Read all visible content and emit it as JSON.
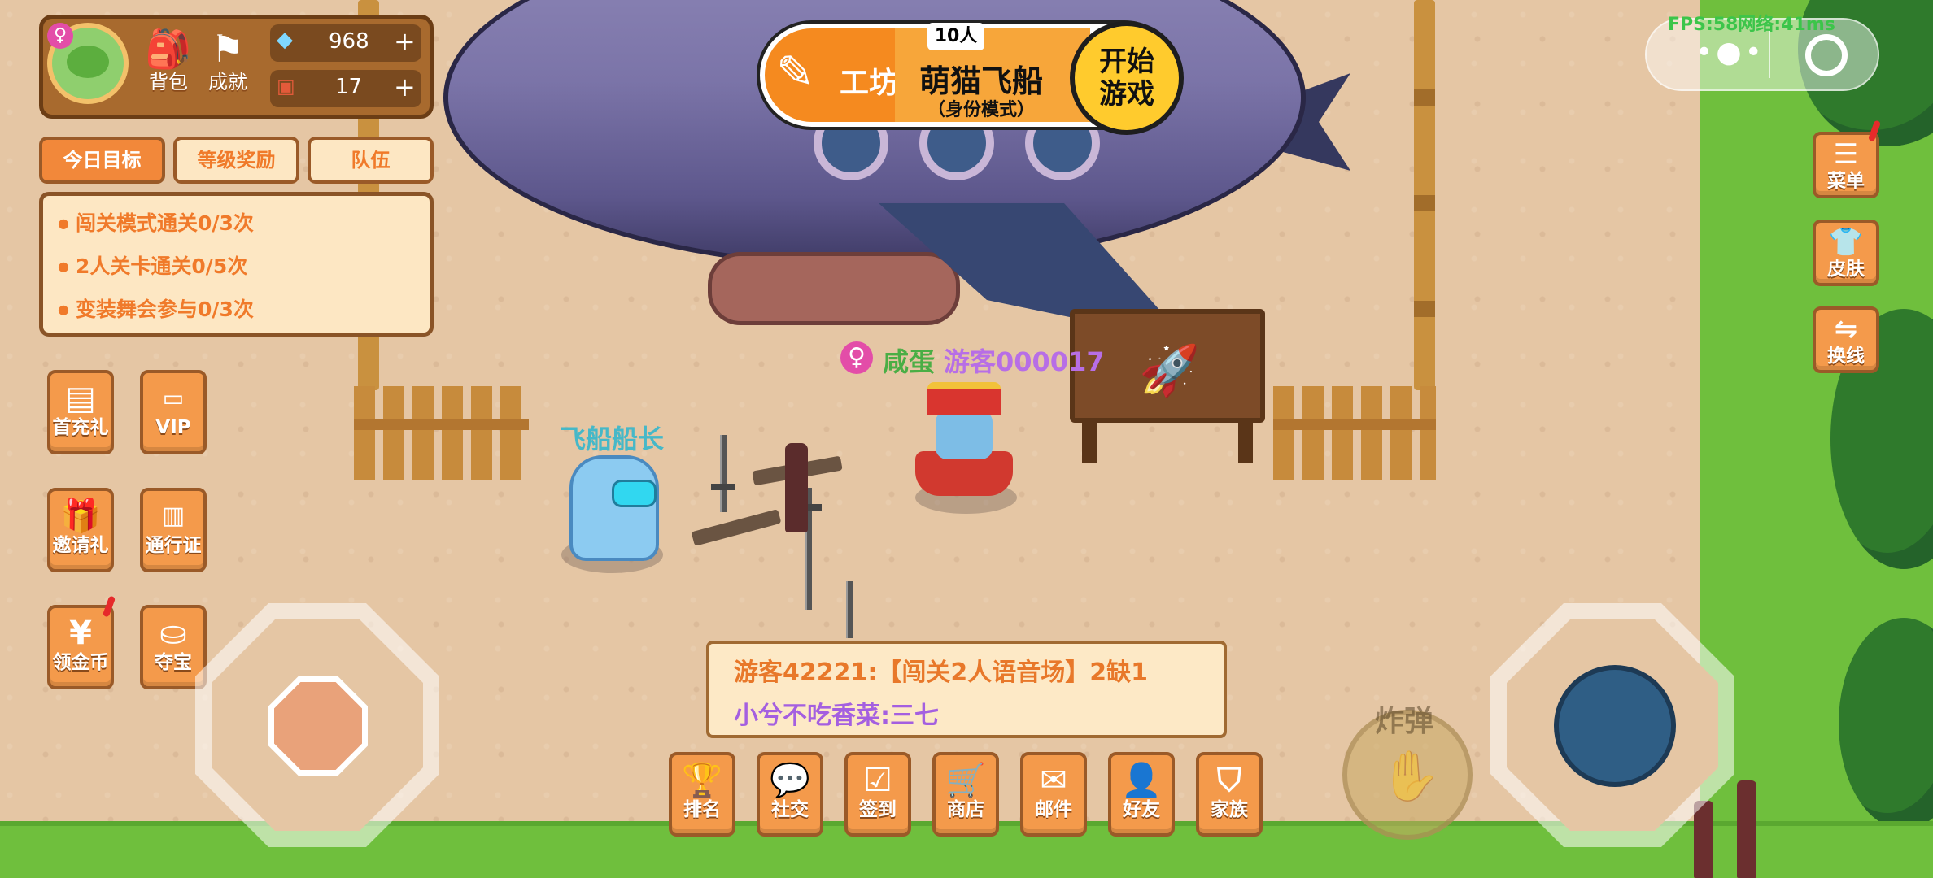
{
  "hud": {
    "avatar_icon": "frog-avatar",
    "gender_icon": "♀",
    "backpack_label": "背包",
    "achievement_label": "成就",
    "diamonds": "968",
    "tickets": "17",
    "add_symbol": "+"
  },
  "goal_tabs": [
    "今日目标",
    "等级奖励",
    "队伍"
  ],
  "goals": [
    "闯关模式通关0/3次",
    "2人关卡通关0/5次",
    "变装舞会参与0/3次"
  ],
  "left_buttons": [
    {
      "label": "首充礼",
      "icon": "first-recharge-icon"
    },
    {
      "label": "VIP",
      "icon": "vip-icon"
    },
    {
      "label": "邀请礼",
      "icon": "gift-icon"
    },
    {
      "label": "通行证",
      "icon": "pass-icon"
    },
    {
      "label": "领金币",
      "icon": "coin-icon"
    },
    {
      "label": "夺宝",
      "icon": "ingot-icon"
    }
  ],
  "mode": {
    "workshop_label": "工坊",
    "players": "10人",
    "title": "萌猫飞船",
    "subtitle": "（身份模式）",
    "start_label": "开始\n游戏"
  },
  "system": {
    "fps_text": "FPS:58网络:41ms"
  },
  "right_buttons": [
    {
      "label": "菜单",
      "icon": "menu-icon"
    },
    {
      "label": "皮肤",
      "icon": "shirt-icon"
    },
    {
      "label": "换线",
      "icon": "switch-icon"
    }
  ],
  "characters": {
    "npc_name": "飞船船长",
    "player_gender": "♀",
    "player_title": "咸蛋",
    "player_name": "游客000017"
  },
  "chat": [
    {
      "text": "游客42221:【闯关2人语音场】2缺1",
      "color": "#e8782a"
    },
    {
      "text": "小兮不吃香菜:三七",
      "color": "#a45fe0"
    }
  ],
  "bottom_buttons": [
    {
      "label": "排名",
      "icon": "trophy-icon"
    },
    {
      "label": "社交",
      "icon": "chat-icon"
    },
    {
      "label": "签到",
      "icon": "calendar-icon"
    },
    {
      "label": "商店",
      "icon": "cart-icon"
    },
    {
      "label": "邮件",
      "icon": "mail-icon"
    },
    {
      "label": "好友",
      "icon": "add-friend-icon"
    },
    {
      "label": "家族",
      "icon": "family-icon"
    }
  ],
  "controls": {
    "bomb_label": "炸弹"
  }
}
